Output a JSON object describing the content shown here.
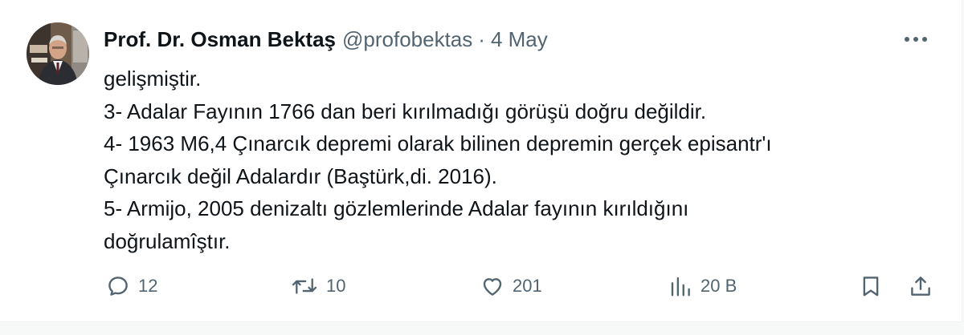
{
  "author": {
    "display_name": "Prof. Dr. Osman Bektaş",
    "handle": "@profobektas",
    "separator": "·",
    "timestamp": "4 May"
  },
  "tweet": {
    "lines": [
      "gelişmiştir.",
      "3- Adalar Fayının 1766 dan beri kırılmadığı görüşü doğru değildir.",
      "4- 1963 M6,4 Çınarcık depremi olarak bilinen depremin gerçek episantr'ı",
      "Çınarcık değil Adalardır (Baştürk,di. 2016).",
      "5- Armijo, 2005 denizaltı gözlemlerinde Adalar fayının kırıldığını",
      "doğrulamîştır."
    ]
  },
  "actions": {
    "replies": "12",
    "retweets": "10",
    "likes": "201",
    "views": "20 B"
  },
  "icons": {
    "more": "more-horizontal-icon",
    "reply": "reply-icon",
    "retweet": "retweet-icon",
    "like": "heart-icon",
    "views": "views-chart-icon",
    "bookmark": "bookmark-icon",
    "share": "share-icon"
  },
  "colors": {
    "text_primary": "#0f1419",
    "text_secondary": "#536471",
    "background": "#ffffff"
  }
}
